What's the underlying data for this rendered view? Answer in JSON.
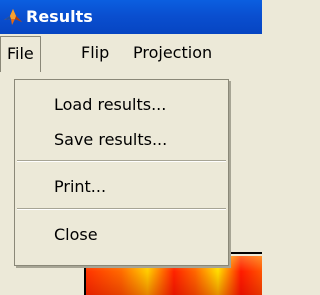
{
  "window": {
    "title": "Results",
    "icon": "matlab-icon"
  },
  "menubar": {
    "items": [
      {
        "label": "File"
      },
      {
        "label": "Flip"
      },
      {
        "label": "Projection"
      }
    ]
  },
  "file_menu": {
    "items": [
      {
        "label": "Load results..."
      },
      {
        "label": "Save results..."
      },
      {
        "label": "Print..."
      },
      {
        "label": "Close"
      }
    ]
  }
}
